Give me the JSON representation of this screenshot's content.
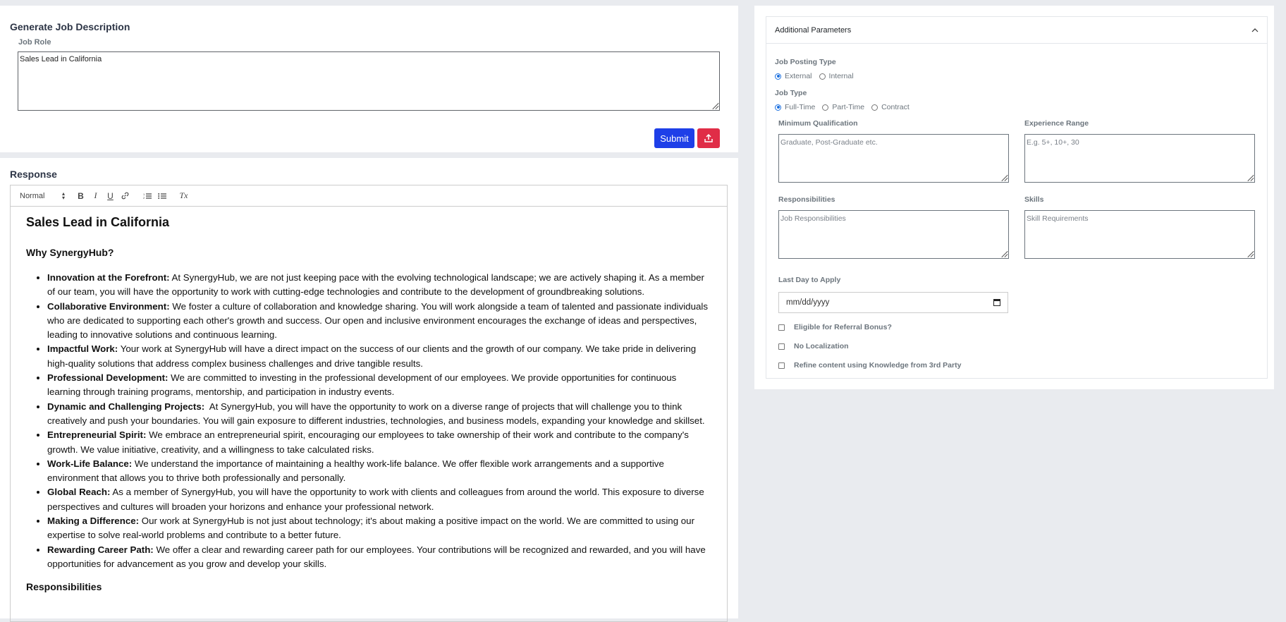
{
  "generate": {
    "title": "Generate Job Description",
    "job_role_label": "Job Role",
    "job_role_value": "Sales Lead in California",
    "submit_label": "Submit"
  },
  "response": {
    "title": "Response",
    "toolbar": {
      "format_select": "Normal",
      "bold": "B",
      "italic": "I",
      "underline": "U",
      "clear": "Tx"
    },
    "heading": "Sales Lead in California",
    "why_heading": "Why SynergyHub?",
    "items": [
      {
        "title": "Innovation at the Forefront:",
        "text": " At SynergyHub, we are not just keeping pace with the evolving technological landscape; we are actively shaping it. As a member of our team, you will have the opportunity to work with cutting-edge technologies and contribute to the development of groundbreaking solutions."
      },
      {
        "title": "Collaborative Environment:",
        "text": " We foster a culture of collaboration and knowledge sharing. You will work alongside a team of talented and passionate individuals who are dedicated to supporting each other's growth and success. Our open and inclusive environment encourages the exchange of ideas and perspectives, leading to innovative solutions and continuous learning."
      },
      {
        "title": "Impactful Work:",
        "text": " Your work at SynergyHub will have a direct impact on the success of our clients and the growth of our company. We take pride in delivering high-quality solutions that address complex business challenges and drive tangible results."
      },
      {
        "title": "Professional Development:",
        "text": " We are committed to investing in the professional development of our employees. We provide opportunities for continuous learning through training programs, mentorship, and participation in industry events."
      },
      {
        "title": "Dynamic and Challenging Projects:",
        "text": "  At SynergyHub, you will have the opportunity to work on a diverse range of projects that will challenge you to think creatively and push your boundaries. You will gain exposure to different industries, technologies, and business models, expanding your knowledge and skillset."
      },
      {
        "title": "Entrepreneurial Spirit:",
        "text": " We embrace an entrepreneurial spirit, encouraging our employees to take ownership of their work and contribute to the company's growth. We value initiative, creativity, and a willingness to take calculated risks."
      },
      {
        "title": "Work-Life Balance:",
        "text": " We understand the importance of maintaining a healthy work-life balance. We offer flexible work arrangements and a supportive environment that allows you to thrive both professionally and personally."
      },
      {
        "title": "Global Reach:",
        "text": " As a member of SynergyHub, you will have the opportunity to work with clients and colleagues from around the world. This exposure to diverse perspectives and cultures will broaden your horizons and enhance your professional network."
      },
      {
        "title": "Making a Difference:",
        "text": " Our work at SynergyHub is not just about technology; it's about making a positive impact on the world. We are committed to using our expertise to solve real-world problems and contribute to a better future."
      },
      {
        "title": "Rewarding Career Path:",
        "text": " We offer a clear and rewarding career path for our employees. Your contributions will be recognized and rewarded, and you will have opportunities for advancement as you grow and develop your skills."
      }
    ],
    "responsibilities_heading": "Responsibilities"
  },
  "params": {
    "title": "Additional Parameters",
    "posting_type_label": "Job Posting Type",
    "posting_options": [
      "External",
      "Internal"
    ],
    "posting_selected": "External",
    "job_type_label": "Job Type",
    "job_type_options": [
      "Full-Time",
      "Part-Time",
      "Contract"
    ],
    "job_type_selected": "Full-Time",
    "min_qual_label": "Minimum Qualification",
    "min_qual_placeholder": "Graduate, Post-Graduate etc.",
    "exp_range_label": "Experience Range",
    "exp_range_placeholder": "E.g. 5+, 10+, 30",
    "responsibilities_label": "Responsibilities",
    "responsibilities_placeholder": "Job Responsibilities",
    "skills_label": "Skills",
    "skills_placeholder": "Skill Requirements",
    "last_day_label": "Last Day to Apply",
    "last_day_placeholder": "mm/dd/yyyy",
    "checkboxes": [
      "Eligible for Referral Bonus?",
      "No Localization",
      "Refine content using Knowledge from 3rd Party"
    ]
  },
  "colors": {
    "submit": "#1e3fe8",
    "upload": "#e02d47",
    "radio_accent": "#1a6fdf"
  }
}
